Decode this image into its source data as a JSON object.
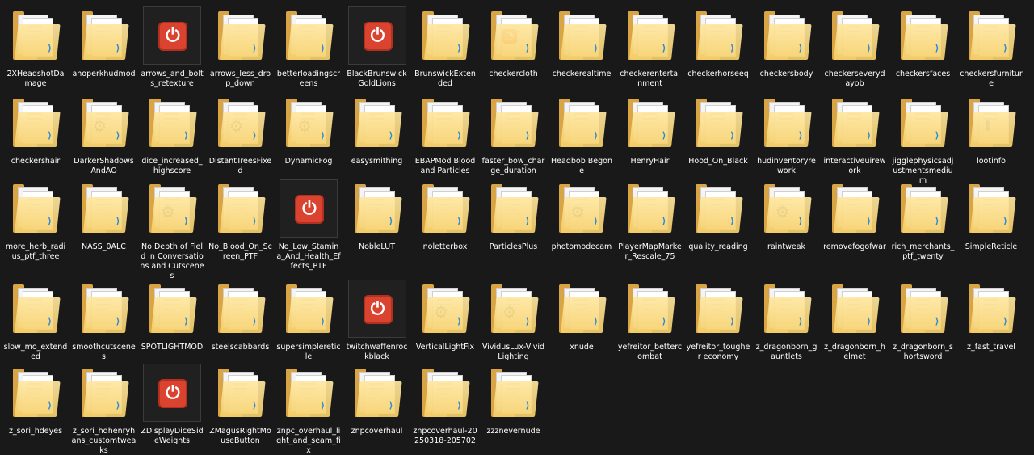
{
  "items": [
    {
      "name": "2XHeadshotDamage",
      "icon": "folder-document",
      "badge": "vscode"
    },
    {
      "name": "anoperkhudmod",
      "icon": "folder-document",
      "badge": "vscode"
    },
    {
      "name": "arrows_and_bolts_retexture",
      "icon": "power-app",
      "badge": "",
      "selected": true
    },
    {
      "name": "arrows_less_drop_down",
      "icon": "folder-document",
      "badge": "vscode"
    },
    {
      "name": "betterloadingscreens",
      "icon": "folder-document",
      "badge": "vscode"
    },
    {
      "name": "BlackBrunswickGoldLions",
      "icon": "power-app",
      "badge": "",
      "selected": true
    },
    {
      "name": "BrunswickExtended",
      "icon": "folder-document",
      "badge": "vscode"
    },
    {
      "name": "checkercloth",
      "icon": "folder-rss",
      "badge": "vscode"
    },
    {
      "name": "checkerealtime",
      "icon": "folder-document",
      "badge": "vscode"
    },
    {
      "name": "checkerentertainment",
      "icon": "folder-document",
      "badge": "vscode"
    },
    {
      "name": "checkerhorseeq",
      "icon": "folder-document",
      "badge": "vscode"
    },
    {
      "name": "checkersbody",
      "icon": "folder-document",
      "badge": "vscode"
    },
    {
      "name": "checkerseverydayob",
      "icon": "folder-document",
      "badge": "vscode"
    },
    {
      "name": "checkersfaces",
      "icon": "folder-document",
      "badge": "vscode"
    },
    {
      "name": "checkersfurniture",
      "icon": "folder-document",
      "badge": "vscode"
    },
    {
      "name": "checkershair",
      "icon": "folder-document",
      "badge": "vscode"
    },
    {
      "name": "DarkerShadowsAndAO",
      "icon": "folder-gear",
      "badge": "vscode"
    },
    {
      "name": "dice_increased_highscore",
      "icon": "folder-document",
      "badge": "vscode"
    },
    {
      "name": "DistantTreesFixed",
      "icon": "folder-gear",
      "badge": "vscode"
    },
    {
      "name": "DynamicFog",
      "icon": "folder-gear",
      "badge": "vscode"
    },
    {
      "name": "easysmithing",
      "icon": "folder-document",
      "badge": "vscode"
    },
    {
      "name": "EBAPMod Bloodand Particles",
      "icon": "folder-document",
      "badge": "vscode"
    },
    {
      "name": "faster_bow_charge_duration",
      "icon": "folder-document",
      "badge": "vscode"
    },
    {
      "name": "Headbob Begone",
      "icon": "folder-document",
      "badge": "vscode"
    },
    {
      "name": "HenryHair",
      "icon": "folder-document",
      "badge": "vscode"
    },
    {
      "name": "Hood_On_Black",
      "icon": "folder-document",
      "badge": "vscode"
    },
    {
      "name": "hudinventoryrework",
      "icon": "folder-document",
      "badge": "vscode"
    },
    {
      "name": "interactiveuirework",
      "icon": "folder-document",
      "badge": "vscode"
    },
    {
      "name": "jigglephysicsadjustmentsmedium",
      "icon": "folder-document",
      "badge": "vscode"
    },
    {
      "name": "lootinfo",
      "icon": "folder-arrow",
      "badge": ""
    },
    {
      "name": "more_herb_radius_ptf_three",
      "icon": "folder-document",
      "badge": "vscode"
    },
    {
      "name": "NASS_0ALC",
      "icon": "folder-document",
      "badge": "vscode"
    },
    {
      "name": "No Depth of Field in Conversations and Cutscenes",
      "icon": "folder-gear",
      "badge": "vscode"
    },
    {
      "name": "No_Blood_On_Screen_PTF",
      "icon": "folder-document",
      "badge": "vscode"
    },
    {
      "name": "No_Low_Stamina_And_Health_Effects_PTF",
      "icon": "power-app",
      "badge": "",
      "selected": true
    },
    {
      "name": "NobleLUT",
      "icon": "folder-document",
      "badge": "vscode"
    },
    {
      "name": "noletterbox",
      "icon": "folder-document",
      "badge": "vscode"
    },
    {
      "name": "ParticlesPlus",
      "icon": "folder-document",
      "badge": "vscode"
    },
    {
      "name": "photomodecam",
      "icon": "folder-gear",
      "badge": "vscode"
    },
    {
      "name": "PlayerMapMarker_Rescale_75",
      "icon": "folder-document",
      "badge": "vscode"
    },
    {
      "name": "quality_reading",
      "icon": "folder-document",
      "badge": "vscode"
    },
    {
      "name": "raintweak",
      "icon": "folder-gear",
      "badge": "vscode"
    },
    {
      "name": "removefogofwar",
      "icon": "folder-document",
      "badge": "vscode"
    },
    {
      "name": "rich_merchants_ptf_twenty",
      "icon": "folder-document",
      "badge": "vscode"
    },
    {
      "name": "SimpleReticle",
      "icon": "folder-document",
      "badge": "vscode"
    },
    {
      "name": "slow_mo_extended",
      "icon": "folder-document",
      "badge": "vscode"
    },
    {
      "name": "smoothcutscenes",
      "icon": "folder-document",
      "badge": "vscode"
    },
    {
      "name": "SPOTLIGHTMOD",
      "icon": "folder-document",
      "badge": "vscode"
    },
    {
      "name": "steelscabbards",
      "icon": "folder-document",
      "badge": "vscode"
    },
    {
      "name": "supersimplereticle",
      "icon": "folder-document",
      "badge": "vscode"
    },
    {
      "name": "twitchwaffenrockblack",
      "icon": "power-app",
      "badge": "",
      "selected": true
    },
    {
      "name": "VerticalLightFix",
      "icon": "folder-gear",
      "badge": "vscode"
    },
    {
      "name": "VividusLux-Vivid Lighting",
      "icon": "folder-gear",
      "badge": "vscode"
    },
    {
      "name": "xnude",
      "icon": "folder-document",
      "badge": "vscode"
    },
    {
      "name": "yefreitor_bettercombat",
      "icon": "folder-document",
      "badge": "vscode"
    },
    {
      "name": "yefreitor_tougher economy",
      "icon": "folder-document",
      "badge": "vscode"
    },
    {
      "name": "z_dragonborn_gauntlets",
      "icon": "folder-document",
      "badge": "vscode"
    },
    {
      "name": "z_dragonborn_helmet",
      "icon": "folder-document",
      "badge": "vscode"
    },
    {
      "name": "z_dragonborn_shortsword",
      "icon": "folder-document",
      "badge": "vscode"
    },
    {
      "name": "z_fast_travel",
      "icon": "folder-document",
      "badge": "vscode"
    },
    {
      "name": "z_sori_hdeyes",
      "icon": "folder-document",
      "badge": "vscode"
    },
    {
      "name": "z_sori_hdhenryhans_customtweaks",
      "icon": "folder-document",
      "badge": "vscode"
    },
    {
      "name": "ZDisplayDiceSideWeights",
      "icon": "power-app",
      "badge": "",
      "selected": true
    },
    {
      "name": "ZMagusRightMouseButton",
      "icon": "folder-document",
      "badge": "vscode"
    },
    {
      "name": "znpc_overhaul_light_and_seam_fix",
      "icon": "folder-document",
      "badge": "vscode"
    },
    {
      "name": "znpcoverhaul",
      "icon": "folder-document",
      "badge": "vscode"
    },
    {
      "name": "znpcoverhaul-20250318-205702",
      "icon": "folder-document",
      "badge": "vscode"
    },
    {
      "name": "zzznevernude",
      "icon": "folder-document",
      "badge": "vscode"
    }
  ]
}
